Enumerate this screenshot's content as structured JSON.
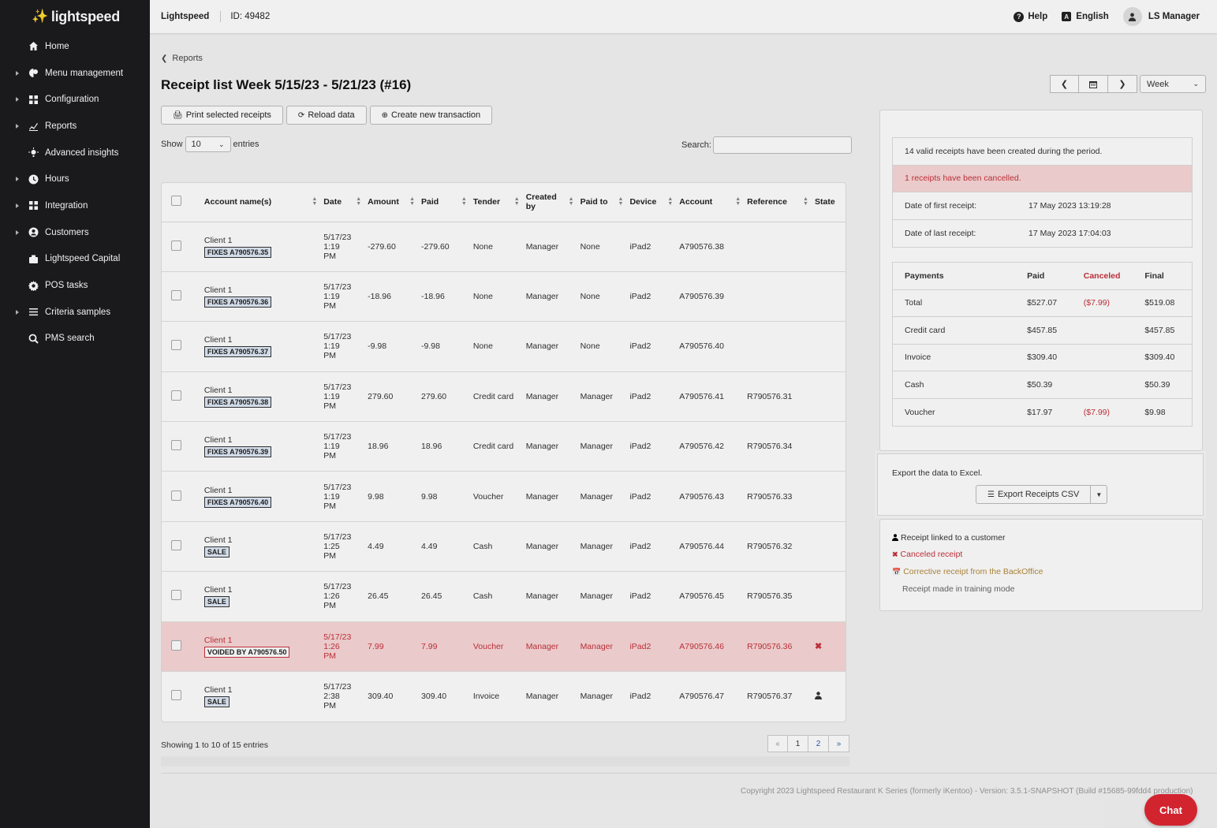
{
  "app": {
    "logo_text": "lightspeed"
  },
  "sidebar": {
    "items": [
      {
        "label": "Home",
        "icon": "home-icon",
        "expandable": false
      },
      {
        "label": "Menu management",
        "icon": "menu-management-icon",
        "expandable": true
      },
      {
        "label": "Configuration",
        "icon": "configuration-icon",
        "expandable": true
      },
      {
        "label": "Reports",
        "icon": "reports-icon",
        "expandable": true
      },
      {
        "label": "Advanced insights",
        "icon": "insights-icon",
        "expandable": false
      },
      {
        "label": "Hours",
        "icon": "clock-icon",
        "expandable": true
      },
      {
        "label": "Integration",
        "icon": "integration-icon",
        "expandable": true
      },
      {
        "label": "Customers",
        "icon": "customers-icon",
        "expandable": true
      },
      {
        "label": "Lightspeed Capital",
        "icon": "capital-icon",
        "expandable": false
      },
      {
        "label": "POS tasks",
        "icon": "gear-icon",
        "expandable": false
      },
      {
        "label": "Criteria samples",
        "icon": "list-icon",
        "expandable": true
      },
      {
        "label": "PMS search",
        "icon": "search-icon",
        "expandable": false
      }
    ]
  },
  "topbar": {
    "brand": "Lightspeed",
    "id_label": "ID: 49482",
    "help": "Help",
    "language": "English",
    "user": "LS Manager"
  },
  "page": {
    "breadcrumb": "Reports",
    "title": "Receipt list Week 5/15/23 - 5/21/23 (#16)",
    "print_btn": "Print selected receipts",
    "reload_btn": "Reload data",
    "create_btn": "Create new transaction",
    "period_select": "Week",
    "show_label": "Show",
    "entries_value": "10",
    "entries_label": "entries",
    "search_label": "Search:",
    "search_value": ""
  },
  "table": {
    "headers": [
      "Account name(s)",
      "Date",
      "Amount",
      "Paid",
      "Tender",
      "Created by",
      "Paid to",
      "Device",
      "Account",
      "Reference",
      "State"
    ],
    "rows": [
      {
        "name": "Client 1",
        "badge": "FIXES A790576.35",
        "date": [
          "5/17/23",
          "1:19",
          "PM"
        ],
        "amount": "-279.60",
        "paid": "-279.60",
        "tender": "None",
        "created_by": "Manager",
        "paid_to": "None",
        "device": "iPad2",
        "account": "A790576.38",
        "reference": "",
        "state": "",
        "voided": false
      },
      {
        "name": "Client 1",
        "badge": "FIXES A790576.36",
        "date": [
          "5/17/23",
          "1:19",
          "PM"
        ],
        "amount": "-18.96",
        "paid": "-18.96",
        "tender": "None",
        "created_by": "Manager",
        "paid_to": "None",
        "device": "iPad2",
        "account": "A790576.39",
        "reference": "",
        "state": "",
        "voided": false
      },
      {
        "name": "Client 1",
        "badge": "FIXES A790576.37",
        "date": [
          "5/17/23",
          "1:19",
          "PM"
        ],
        "amount": "-9.98",
        "paid": "-9.98",
        "tender": "None",
        "created_by": "Manager",
        "paid_to": "None",
        "device": "iPad2",
        "account": "A790576.40",
        "reference": "",
        "state": "",
        "voided": false
      },
      {
        "name": "Client 1",
        "badge": "FIXES A790576.38",
        "date": [
          "5/17/23",
          "1:19",
          "PM"
        ],
        "amount": "279.60",
        "paid": "279.60",
        "tender": "Credit card",
        "created_by": "Manager",
        "paid_to": "Manager",
        "device": "iPad2",
        "account": "A790576.41",
        "reference": "R790576.31",
        "state": "",
        "voided": false
      },
      {
        "name": "Client 1",
        "badge": "FIXES A790576.39",
        "date": [
          "5/17/23",
          "1:19",
          "PM"
        ],
        "amount": "18.96",
        "paid": "18.96",
        "tender": "Credit card",
        "created_by": "Manager",
        "paid_to": "Manager",
        "device": "iPad2",
        "account": "A790576.42",
        "reference": "R790576.34",
        "state": "",
        "voided": false
      },
      {
        "name": "Client 1",
        "badge": "FIXES A790576.40",
        "date": [
          "5/17/23",
          "1:19",
          "PM"
        ],
        "amount": "9.98",
        "paid": "9.98",
        "tender": "Voucher",
        "created_by": "Manager",
        "paid_to": "Manager",
        "device": "iPad2",
        "account": "A790576.43",
        "reference": "R790576.33",
        "state": "",
        "voided": false
      },
      {
        "name": "Client 1",
        "badge": "SALE",
        "date": [
          "5/17/23",
          "1:25",
          "PM"
        ],
        "amount": "4.49",
        "paid": "4.49",
        "tender": "Cash",
        "created_by": "Manager",
        "paid_to": "Manager",
        "device": "iPad2",
        "account": "A790576.44",
        "reference": "R790576.32",
        "state": "",
        "voided": false
      },
      {
        "name": "Client 1",
        "badge": "SALE",
        "date": [
          "5/17/23",
          "1:26",
          "PM"
        ],
        "amount": "26.45",
        "paid": "26.45",
        "tender": "Cash",
        "created_by": "Manager",
        "paid_to": "Manager",
        "device": "iPad2",
        "account": "A790576.45",
        "reference": "R790576.35",
        "state": "",
        "voided": false
      },
      {
        "name": "Client 1",
        "badge": "VOIDED BY A790576.50",
        "date": [
          "5/17/23",
          "1:26",
          "PM"
        ],
        "amount": "7.99",
        "paid": "7.99",
        "tender": "Voucher",
        "created_by": "Manager",
        "paid_to": "Manager",
        "device": "iPad2",
        "account": "A790576.46",
        "reference": "R790576.36",
        "state": "canceled",
        "voided": true
      },
      {
        "name": "Client 1",
        "badge": "SALE",
        "date": [
          "5/17/23",
          "2:38",
          "PM"
        ],
        "amount": "309.40",
        "paid": "309.40",
        "tender": "Invoice",
        "created_by": "Manager",
        "paid_to": "Manager",
        "device": "iPad2",
        "account": "A790576.47",
        "reference": "R790576.37",
        "state": "customer",
        "voided": false
      }
    ],
    "footer": "Showing 1 to 10 of 15 entries",
    "pager": [
      "«",
      "1",
      "2",
      "»"
    ]
  },
  "summary": {
    "valid_text": "14 valid receipts have been created during the period.",
    "cancelled_text": "1 receipts have been cancelled.",
    "first_label": "Date of first receipt:",
    "first_value": "17 May 2023 13:19:28",
    "last_label": "Date of last receipt:",
    "last_value": "17 May 2023 17:04:03"
  },
  "payments": {
    "headers": [
      "Payments",
      "Paid",
      "Canceled",
      "Final"
    ],
    "rows": [
      [
        "Total",
        "$527.07",
        "($7.99)",
        "$519.08"
      ],
      [
        "Credit card",
        "$457.85",
        "",
        "$457.85"
      ],
      [
        "Invoice",
        "$309.40",
        "",
        "$309.40"
      ],
      [
        "Cash",
        "$50.39",
        "",
        "$50.39"
      ],
      [
        "Voucher",
        "$17.97",
        "($7.99)",
        "$9.98"
      ]
    ]
  },
  "export": {
    "label": "Export the data to Excel.",
    "button": "Export Receipts CSV"
  },
  "legend": {
    "customer": "Receipt linked to a customer",
    "canceled": "Canceled receipt",
    "corrective": "Corrective receipt from the BackOffice",
    "training": "Receipt made in training mode"
  },
  "footer": {
    "copyright": "Copyright 2023 Lightspeed Restaurant K Series (formerly iKentoo) - Version: 3.5.1-SNAPSHOT (Build #15685-99fdd4 production)"
  },
  "chat": {
    "label": "Chat"
  },
  "colors": {
    "sidebar_bg": "#1c1c1f",
    "brand_red": "#e8413a",
    "danger": "#c7323c",
    "danger_bg": "#f9d7d7",
    "chat": "#d1242f",
    "corrective": "#b58a3c"
  }
}
